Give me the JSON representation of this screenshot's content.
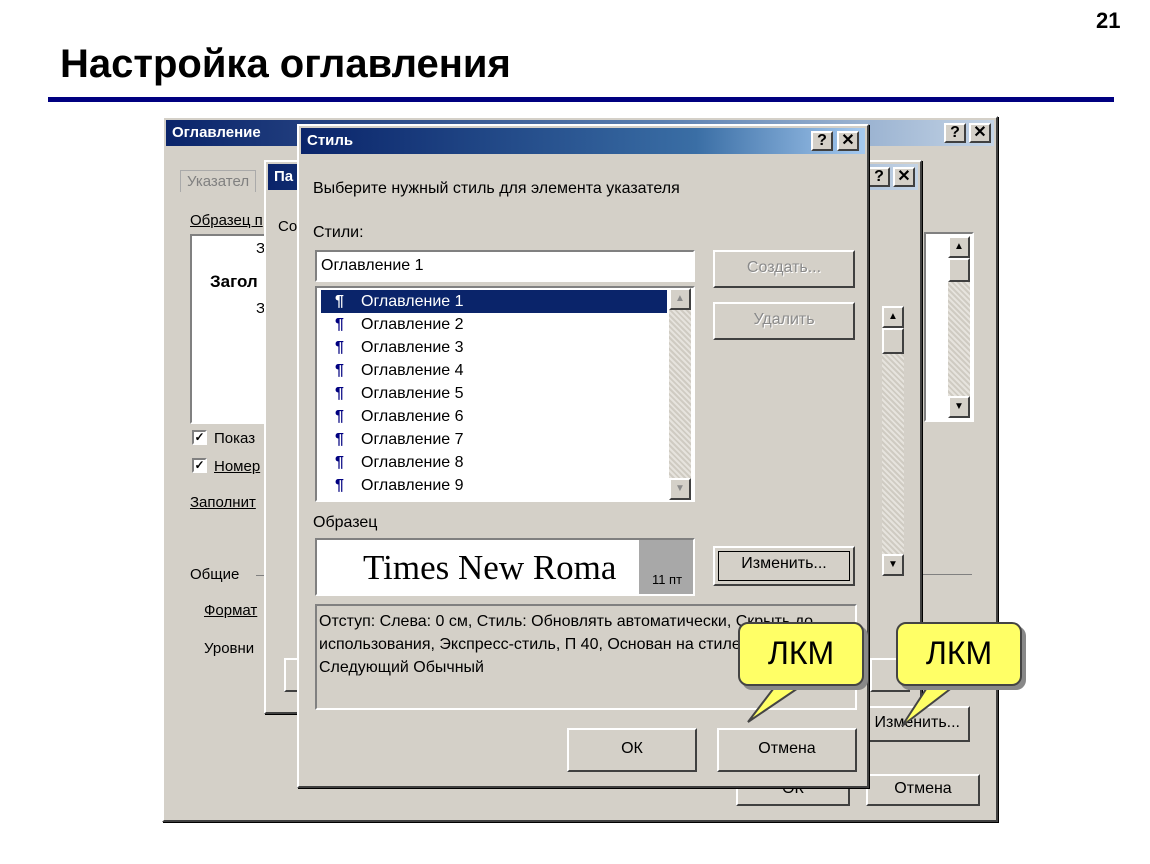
{
  "slide": {
    "number": "21",
    "title": "Настройка оглавления"
  },
  "toc_dialog": {
    "title": "Оглавление",
    "tab": "Указател",
    "preview_label": "Образец п",
    "preview_lines": [
      "З",
      "Загол",
      "З"
    ],
    "checkbox1": "Показ",
    "checkbox2": "Номер",
    "fill_label": "Заполнит",
    "general_label": "Общие",
    "format_label": "Формат",
    "levels_label": "Уровни",
    "ok_label": "ОК",
    "cancel_label": "Отмена",
    "help_icon": "?",
    "close_icon": "✕"
  },
  "middle_dialog": {
    "title": "Па",
    "label": "Со",
    "modify_label": "Изменить..."
  },
  "style_dialog": {
    "title": "Стиль",
    "prompt": "Выберите нужный стиль для элемента указателя",
    "styles_label": "Стили:",
    "style_input_value": "Оглавление 1",
    "create_button": "Создать...",
    "delete_button": "Удалить",
    "styles": [
      "Оглавление 1",
      "Оглавление 2",
      "Оглавление 3",
      "Оглавление 4",
      "Оглавление 5",
      "Оглавление 6",
      "Оглавление 7",
      "Оглавление 8",
      "Оглавление 9"
    ],
    "selected_index": 0,
    "preview_label": "Образец",
    "preview_font": "Times New Roma",
    "preview_size": "11 пт",
    "modify_button": "Изменить...",
    "description": "Отступ: Слева:  0 см, Стиль: Обновлять автоматически, Скрыть до использования, Экспресс-стиль, П 40, Основан на стиле: Обычный, Следующий Обычный",
    "ok_button": "ОК",
    "cancel_button": "Отмена",
    "help_icon": "?",
    "close_icon": "✕"
  },
  "callouts": [
    "ЛКМ",
    "ЛКМ"
  ]
}
